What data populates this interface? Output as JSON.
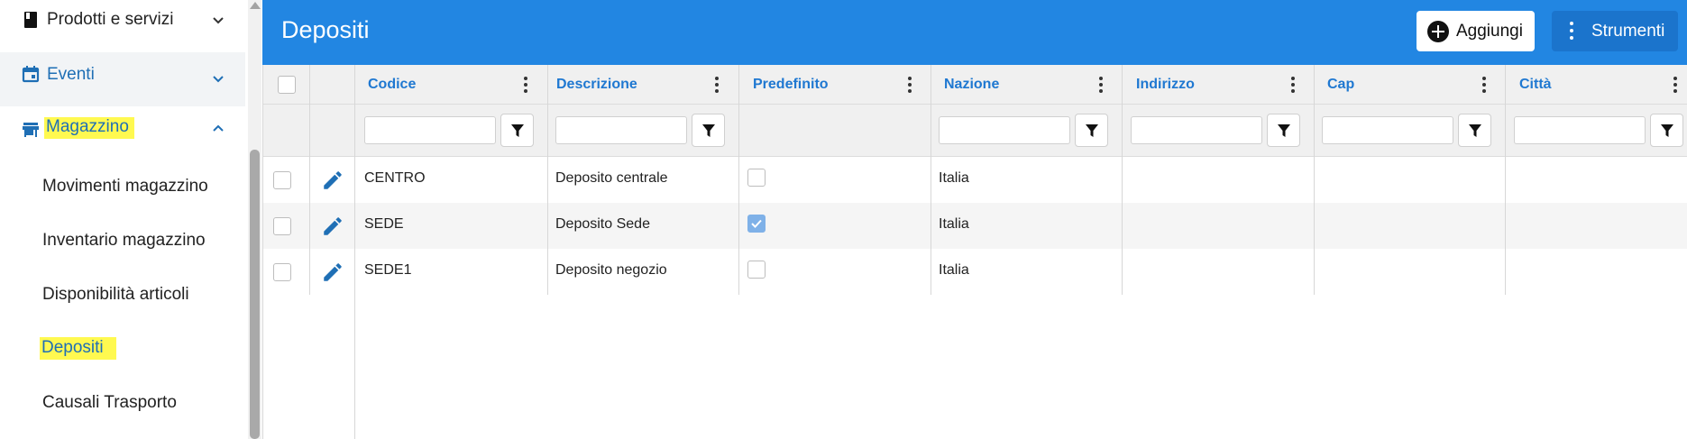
{
  "sidebar": {
    "items": [
      {
        "label": "Prodotti e servizi"
      },
      {
        "label": "Eventi"
      },
      {
        "label": "Magazzino"
      }
    ],
    "magazzino_sub": [
      {
        "label": "Movimenti magazzino"
      },
      {
        "label": "Inventario magazzino"
      },
      {
        "label": "Disponibilità articoli"
      },
      {
        "label": "Depositi"
      },
      {
        "label": "Causali Trasporto"
      }
    ]
  },
  "header": {
    "title": "Depositi",
    "add_label": "Aggiungi",
    "tools_label": "Strumenti"
  },
  "colors": {
    "primary": "#2286e2",
    "link": "#1f78d1",
    "highlight": "#fff950"
  },
  "grid": {
    "columns": [
      {
        "label": "Codice"
      },
      {
        "label": "Descrizione"
      },
      {
        "label": "Predefinito"
      },
      {
        "label": "Nazione"
      },
      {
        "label": "Indirizzo"
      },
      {
        "label": "Cap"
      },
      {
        "label": "Città"
      }
    ],
    "rows": [
      {
        "codice": "CENTRO",
        "descrizione": "Deposito centrale",
        "predefinito": false,
        "nazione": "Italia",
        "indirizzo": "",
        "cap": "",
        "citta": ""
      },
      {
        "codice": "SEDE",
        "descrizione": "Deposito Sede",
        "predefinito": true,
        "nazione": "Italia",
        "indirizzo": "",
        "cap": "",
        "citta": ""
      },
      {
        "codice": "SEDE1",
        "descrizione": "Deposito negozio",
        "predefinito": false,
        "nazione": "Italia",
        "indirizzo": "",
        "cap": "",
        "citta": ""
      }
    ]
  },
  "icons": {
    "menu_book": "book-icon",
    "calendar": "calendar-icon",
    "store": "store-icon",
    "edit": "pencil-icon",
    "filter": "filter-icon",
    "add": "add-circle-icon",
    "more": "more-vert-icon"
  }
}
